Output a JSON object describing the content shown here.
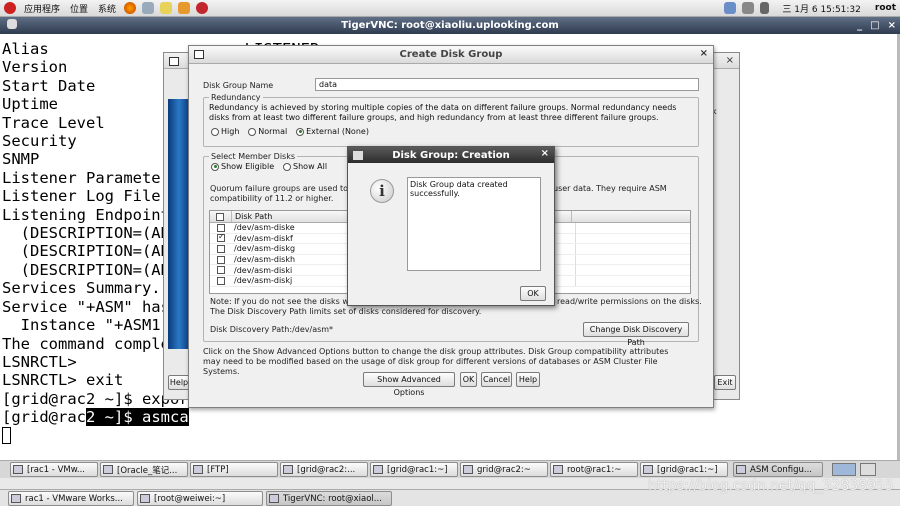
{
  "top_panel": {
    "menus": [
      "应用程序",
      "位置",
      "系统"
    ],
    "clock": "三 1月  6 15:51:32",
    "user": "root"
  },
  "vnc": {
    "title": "TigerVNC: root@xiaoliu.uplooking.com",
    "controls": [
      "_",
      "□",
      "×"
    ]
  },
  "terminal": {
    "lines": [
      "Alias                     LISTENER",
      "Version",
      "Start Date",
      "Uptime",
      "Trace Level",
      "Security",
      "SNMP",
      "Listener Parameter",
      "Listener Log File",
      "Listening Endpoint",
      "  (DESCRIPTION=(AD",
      "  (DESCRIPTION=(AD",
      "  (DESCRIPTION=(AD",
      "Services Summary..",
      "Service \"+ASM\" has",
      "  Instance \"+ASM1\"",
      "The command comple",
      "LSNRCTL>",
      "LSNRCTL> exit",
      "[grid@rac2 ~]$ expor"
    ],
    "last_prefix": "[grid@rac",
    "last_selected": "2 ~]$ asmca"
  },
  "asm_window": {
    "side_letter": "k",
    "exit_label": "Exit",
    "help_label": "Help"
  },
  "create_disk_group": {
    "title": "Create Disk Group",
    "name_label": "Disk Group Name",
    "name_value": "data",
    "redundancy": {
      "legend": "Redundancy",
      "description": "Redundancy is achieved by storing multiple copies of the data on different failure groups. Normal redundancy needs disks from at least two different failure groups, and high redundancy from at least three different failure groups.",
      "options": [
        {
          "label": "High",
          "selected": false
        },
        {
          "label": "Normal",
          "selected": false
        },
        {
          "label": "External (None)",
          "selected": true
        }
      ]
    },
    "member_disks": {
      "legend": "Select Member Disks",
      "options": [
        {
          "label": "Show Eligible",
          "selected": true
        },
        {
          "label": "Show All",
          "selected": false
        }
      ],
      "quorum_text_left": "Quorum failure groups are used to stor",
      "quorum_text_right": "user data. They require ASM",
      "quorum_text_line2": "compatibility of 11.2 or higher.",
      "column_header": "Disk Path",
      "disks": [
        {
          "path": "/dev/asm-diske",
          "checked": false
        },
        {
          "path": "/dev/asm-diskf",
          "checked": true
        },
        {
          "path": "/dev/asm-diskg",
          "checked": false
        },
        {
          "path": "/dev/asm-diskh",
          "checked": false
        },
        {
          "path": "/dev/asm-diski",
          "checked": false
        },
        {
          "path": "/dev/asm-diskj",
          "checked": false
        }
      ],
      "note_left": "Note: If you do not see the disks which",
      "note_right": "read/write permissions on the disks.",
      "note_line2": "The Disk Discovery Path limits set of disks considered for discovery.",
      "discovery_label": "Disk Discovery Path:/dev/asm*",
      "change_path_button": "Change Disk Discovery Path"
    },
    "advanced_text": "Click on the Show Advanced Options button to change the disk group attributes. Disk Group compatibility attributes may need to be modified based on the usage of disk group for different versions of databases or ASM Cluster File Systems.",
    "buttons": {
      "advanced": "Show Advanced Options",
      "ok": "OK",
      "cancel": "Cancel",
      "help": "Help"
    }
  },
  "creation_popup": {
    "title": "Disk Group: Creation",
    "message": "Disk Group data created successfully.",
    "ok": "OK"
  },
  "taskbar_vnc": [
    {
      "label": "[rac1 - VMw...",
      "active": false
    },
    {
      "label": "[Oracle_笔记...",
      "active": false
    },
    {
      "label": "[FTP]",
      "active": false
    },
    {
      "label": "[grid@rac2:...",
      "active": false
    },
    {
      "label": "[grid@rac1:~]",
      "active": false
    },
    {
      "label": "grid@rac2:~",
      "active": false
    },
    {
      "label": "root@rac1:~",
      "active": false
    },
    {
      "label": "[grid@rac1:~]",
      "active": false
    },
    {
      "label": "ASM Configu...",
      "active": true
    }
  ],
  "taskbar_host": [
    {
      "label": "rac1 - VMware Works...",
      "active": false
    },
    {
      "label": "[root@weiwei:~]",
      "active": false
    },
    {
      "label": "TigerVNC: root@xiaol...",
      "active": true
    }
  ],
  "watermark": "https://blog.csdn.net/qq_32838955"
}
